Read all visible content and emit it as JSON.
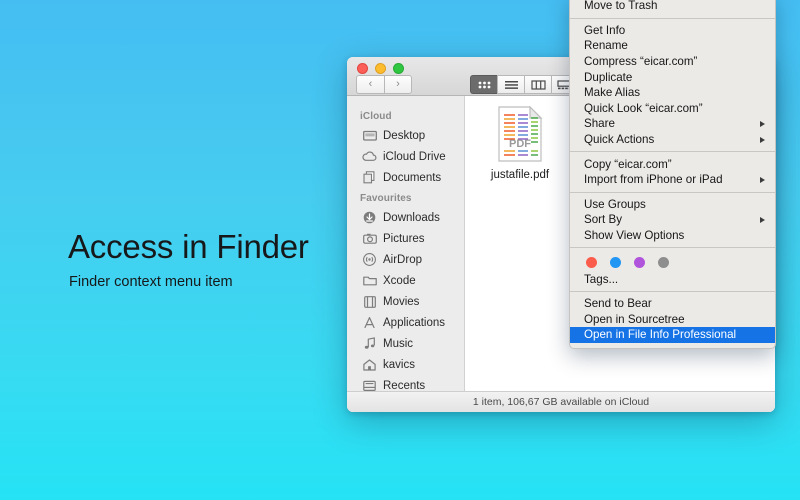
{
  "background": {
    "gradient_top": "#45bdf2",
    "gradient_bottom": "#25e3f5"
  },
  "promo": {
    "headline": "Access in Finder",
    "subhead": "Finder context menu item"
  },
  "finder": {
    "traffic_lights": [
      {
        "name": "close",
        "color": "#fc5f57"
      },
      {
        "name": "minimize",
        "color": "#fdbc2d"
      },
      {
        "name": "zoom",
        "color": "#2fc73f"
      }
    ],
    "nav": {
      "back": "‹",
      "forward": "›"
    },
    "view_modes": [
      {
        "name": "icon-view",
        "active": true
      },
      {
        "name": "list-view",
        "active": false
      },
      {
        "name": "column-view",
        "active": false
      },
      {
        "name": "gallery-view",
        "active": false
      }
    ],
    "sidebar": [
      {
        "type": "header",
        "label": "iCloud"
      },
      {
        "type": "item",
        "label": "Desktop",
        "icon": "desktop-icon"
      },
      {
        "type": "item",
        "label": "iCloud Drive",
        "icon": "cloud-icon"
      },
      {
        "type": "item",
        "label": "Documents",
        "icon": "documents-icon"
      },
      {
        "type": "header",
        "label": "Favourites"
      },
      {
        "type": "item",
        "label": "Downloads",
        "icon": "downloads-icon"
      },
      {
        "type": "item",
        "label": "Pictures",
        "icon": "camera-icon"
      },
      {
        "type": "item",
        "label": "AirDrop",
        "icon": "airdrop-icon"
      },
      {
        "type": "item",
        "label": "Xcode",
        "icon": "folder-icon"
      },
      {
        "type": "item",
        "label": "Movies",
        "icon": "movies-icon"
      },
      {
        "type": "item",
        "label": "Applications",
        "icon": "applications-icon"
      },
      {
        "type": "item",
        "label": "Music",
        "icon": "music-icon"
      },
      {
        "type": "item",
        "label": "kavics",
        "icon": "home-icon"
      },
      {
        "type": "item",
        "label": "Recents",
        "icon": "recents-icon"
      }
    ],
    "file": {
      "name": "justafile.pdf",
      "icon": "pdf-file-icon"
    },
    "status": "1 item, 106,67 GB available on iCloud"
  },
  "context_menu": {
    "clipped_top_item": "Move to Trash",
    "highlight_color": "#1573e6",
    "groups": [
      {
        "items": [
          {
            "label": "Get Info",
            "submenu": false
          },
          {
            "label": "Rename",
            "submenu": false
          },
          {
            "label": "Compress “eicar.com”",
            "submenu": false
          },
          {
            "label": "Duplicate",
            "submenu": false
          },
          {
            "label": "Make Alias",
            "submenu": false
          },
          {
            "label": "Quick Look “eicar.com”",
            "submenu": false
          },
          {
            "label": "Share",
            "submenu": true
          },
          {
            "label": "Quick Actions",
            "submenu": true
          }
        ]
      },
      {
        "items": [
          {
            "label": "Copy “eicar.com”",
            "submenu": false
          },
          {
            "label": "Import from iPhone or iPad",
            "submenu": true
          }
        ]
      },
      {
        "items": [
          {
            "label": "Use Groups",
            "submenu": false
          },
          {
            "label": "Sort By",
            "submenu": true
          },
          {
            "label": "Show View Options",
            "submenu": false
          }
        ]
      },
      {
        "tags": {
          "colors": [
            "#fb5d4c",
            "#2196f3",
            "#b055db",
            "#8e8e8e"
          ],
          "label": "Tags..."
        }
      },
      {
        "items": [
          {
            "label": "Send to Bear",
            "submenu": false
          },
          {
            "label": "Open in Sourcetree",
            "submenu": false
          },
          {
            "label": "Open in File Info Professional",
            "submenu": false,
            "selected": true
          }
        ]
      }
    ]
  }
}
